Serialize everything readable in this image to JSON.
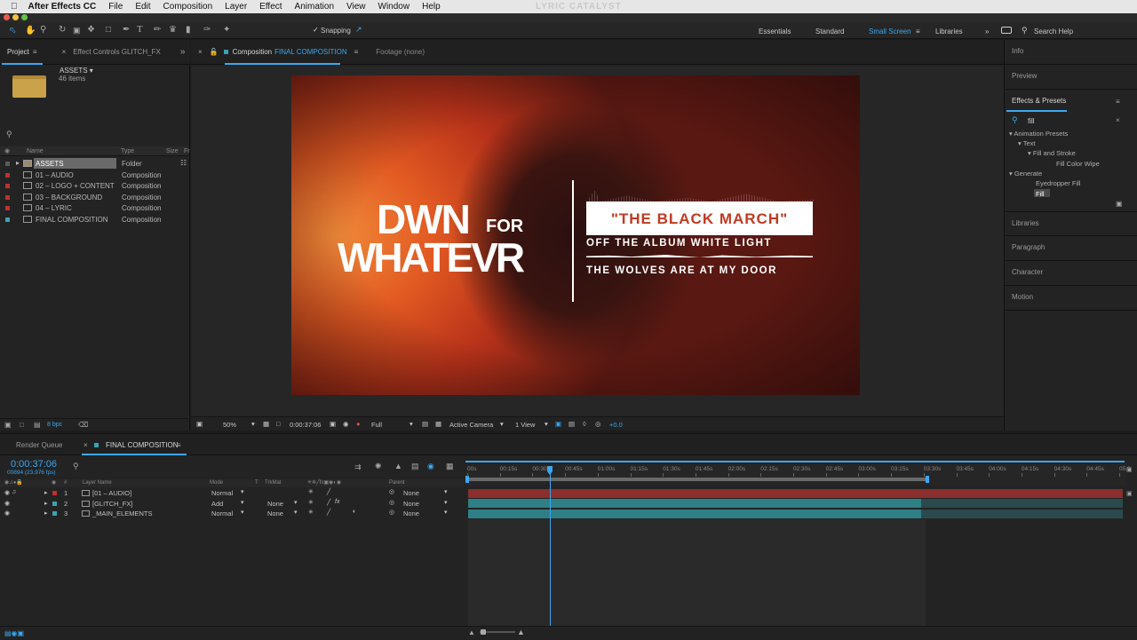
{
  "watermark": "LYRIC CATALYST",
  "menu": [
    "After Effects CC",
    "File",
    "Edit",
    "Composition",
    "Layer",
    "Effect",
    "Animation",
    "View",
    "Window",
    "Help"
  ],
  "toolbar": {
    "snapping": "Snapping",
    "workspaces": [
      "Essentials",
      "Standard",
      "Small Screen",
      "Libraries"
    ],
    "search": "Search Help"
  },
  "project": {
    "tab": "Project",
    "tab2": "Effect Controls GLITCH_FX",
    "folder_name": "ASSETS ▾",
    "folder_count": "46 items",
    "cols": [
      "Name",
      "Type",
      "Size",
      "Fr"
    ],
    "rows": [
      {
        "name": "ASSETS",
        "type": "Folder",
        "color": "#5a5a5a"
      },
      {
        "name": "01 – AUDIO",
        "type": "Composition",
        "color": "#c03030"
      },
      {
        "name": "02 – LOGO + CONTENT",
        "type": "Composition",
        "color": "#c03030"
      },
      {
        "name": "03 – BACKGROUND",
        "type": "Composition",
        "color": "#c03030"
      },
      {
        "name": "04 – LYRIC",
        "type": "Composition",
        "color": "#c03030"
      },
      {
        "name": "FINAL COMPOSITION",
        "type": "Composition",
        "color": "#3aa3b0"
      }
    ],
    "bpc": "8 bpc"
  },
  "comp": {
    "tab_prefix": "Composition",
    "tab_name": "FINAL COMPOSITION",
    "footage": "Footage (none)",
    "zoom": "50%",
    "time": "0:00:37:06",
    "res": "Full",
    "camera": "Active Camera",
    "view": "1 View",
    "exposure": "+0.0"
  },
  "artwork": {
    "logo1": "DWN",
    "logo_for": "FOR",
    "logo2": "WHATEVR",
    "title": "\"THE BLACK MARCH\"",
    "line1": "OFF THE ALBUM WHITE LIGHT",
    "line2": "THE WOLVES ARE AT MY DOOR"
  },
  "right": {
    "info": "Info",
    "preview": "Preview",
    "effects": "Effects & Presets",
    "search": "fill",
    "tree": [
      "▾ Animation Presets",
      "▾ Text",
      "▾ Fill and Stroke",
      "Fill Color Wipe",
      "▾ Generate",
      "Eyedropper Fill",
      "Fill"
    ],
    "panels": [
      "Libraries",
      "Paragraph",
      "Character",
      "Motion"
    ]
  },
  "timeline": {
    "render": "Render Queue",
    "tab": "FINAL COMPOSITION",
    "time": "0:00:37:06",
    "frames": "00894 (23.976 fps)",
    "cols": [
      "#",
      "Layer Name",
      "Mode",
      "T",
      "TrkMat",
      "Parent"
    ],
    "layers": [
      {
        "num": "1",
        "name": "[01 – AUDIO]",
        "mode": "Normal",
        "trk": "",
        "parent": "None",
        "color": "#c03030"
      },
      {
        "num": "2",
        "name": "[GLITCH_FX]",
        "mode": "Add",
        "trk": "None",
        "parent": "None",
        "color": "#3aa3b0"
      },
      {
        "num": "3",
        "name": "_MAIN_ELEMENTS",
        "mode": "Normal",
        "trk": "None",
        "parent": "None",
        "color": "#3aa3b0"
      }
    ],
    "ruler": [
      "00s",
      "00:15s",
      "00:30s",
      "00:45s",
      "01:00s",
      "01:15s",
      "01:30s",
      "01:45s",
      "02:00s",
      "02:15s",
      "02:30s",
      "02:45s",
      "03:00s",
      "03:15s",
      "03:30s",
      "03:45s",
      "04:00s",
      "04:15s",
      "04:30s",
      "04:45s",
      "05:0"
    ]
  }
}
